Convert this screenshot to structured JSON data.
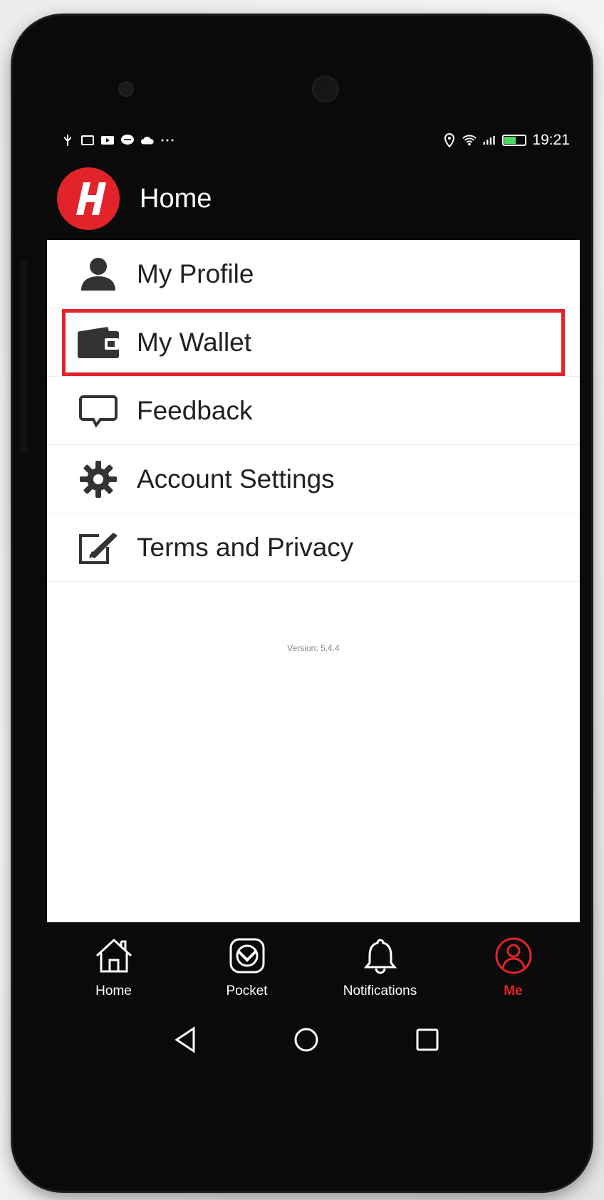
{
  "status_bar": {
    "time": "19:21",
    "left_icons": [
      "usb-icon",
      "image-icon",
      "video-icon",
      "chat-icon",
      "cloud-icon",
      "more-icon"
    ],
    "right_icons": [
      "location-icon",
      "wifi-icon",
      "signal-icon",
      "battery-icon"
    ]
  },
  "app_bar": {
    "title": "Home"
  },
  "menu": {
    "items": [
      {
        "label": "My Profile",
        "icon": "person-icon"
      },
      {
        "label": "My Wallet",
        "icon": "wallet-icon"
      },
      {
        "label": "Feedback",
        "icon": "speech-bubble-icon"
      },
      {
        "label": "Account Settings",
        "icon": "gear-icon"
      },
      {
        "label": "Terms and Privacy",
        "icon": "edit-document-icon"
      }
    ],
    "highlighted": "My Wallet"
  },
  "version": "Version: 5.4.4",
  "bottom_nav": {
    "items": [
      {
        "label": "Home",
        "icon": "home-icon"
      },
      {
        "label": "Pocket",
        "icon": "pocket-icon"
      },
      {
        "label": "Notifications",
        "icon": "bell-icon"
      },
      {
        "label": "Me",
        "icon": "user-circle-icon"
      }
    ],
    "active": "Me"
  },
  "colors": {
    "accent": "#e2232a",
    "background": "#0a0a0a",
    "surface": "#ffffff"
  }
}
